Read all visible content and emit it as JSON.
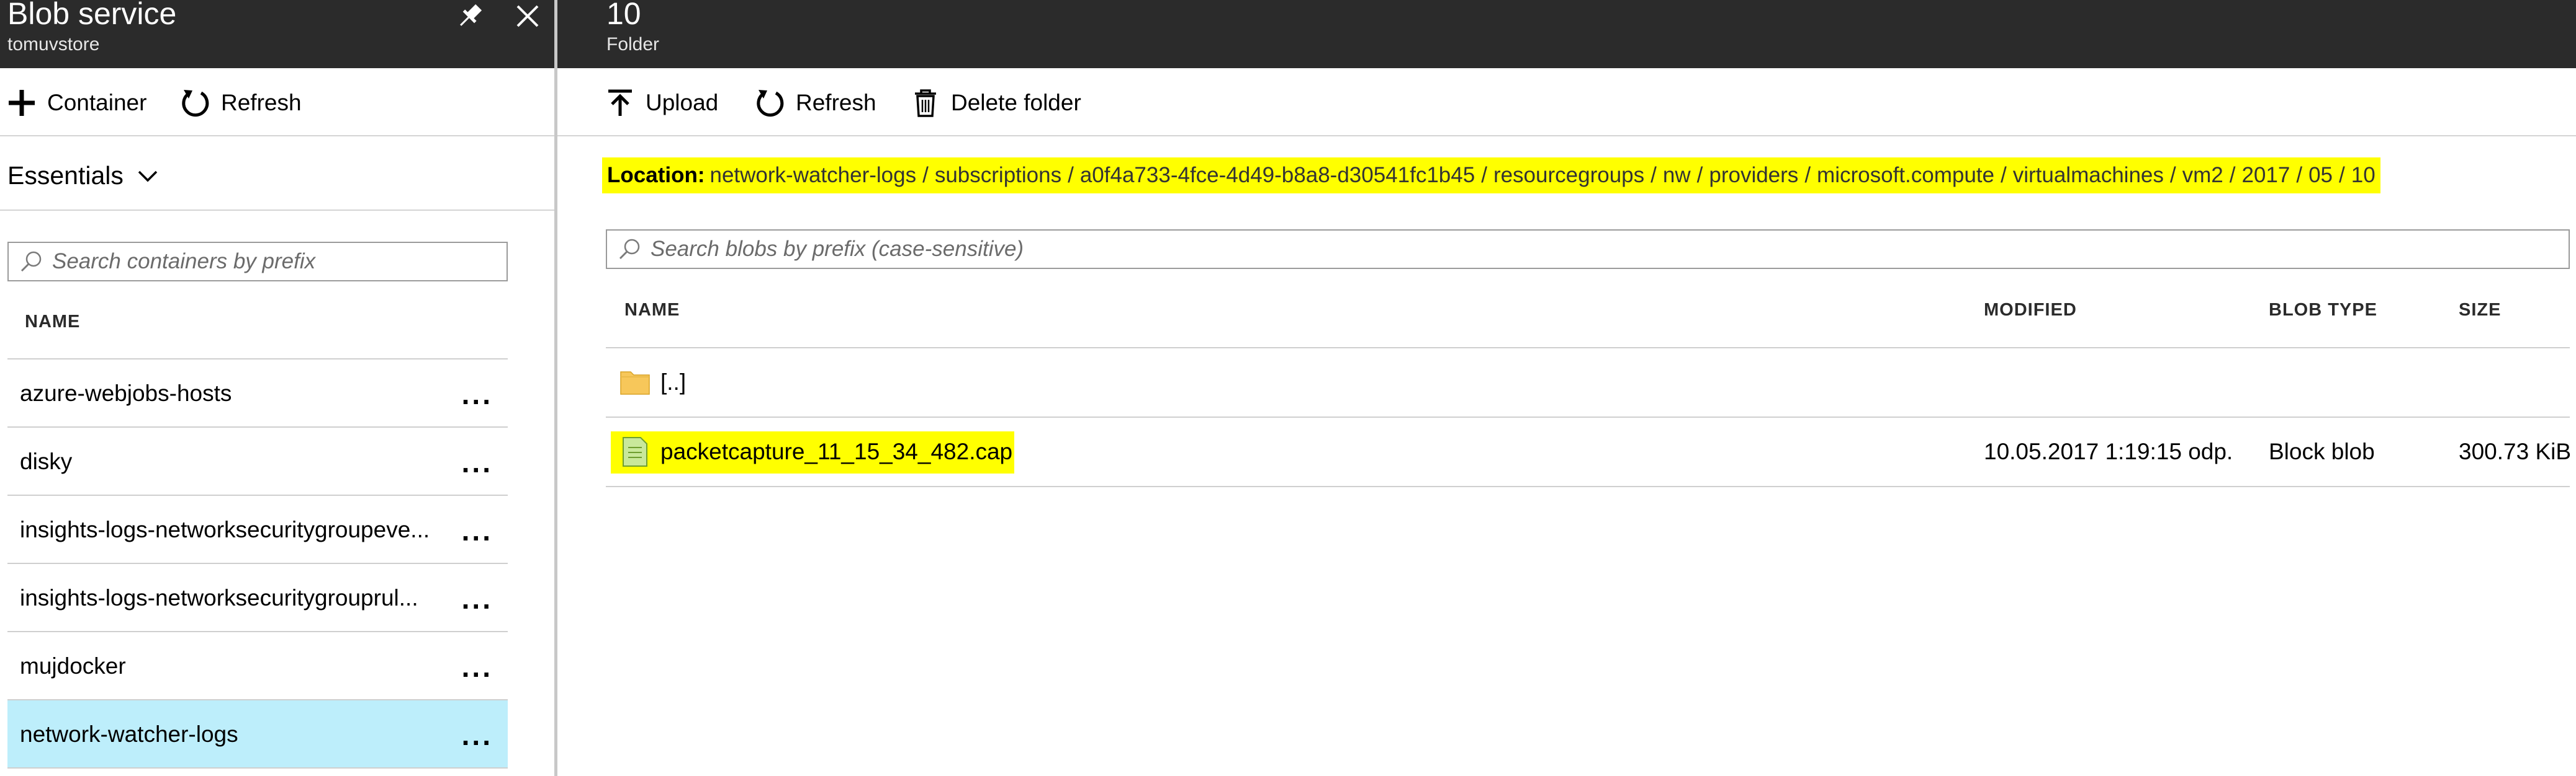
{
  "left_blade": {
    "title": "Blob service",
    "subtitle": "tomuvstore",
    "toolbar": {
      "container_label": "Container",
      "refresh_label": "Refresh"
    },
    "essentials_label": "Essentials",
    "search_placeholder": "Search containers by prefix",
    "column_name": "NAME",
    "containers": [
      {
        "name": "azure-webjobs-hosts",
        "more": "..."
      },
      {
        "name": "disky",
        "more": "..."
      },
      {
        "name": "insights-logs-networksecuritygroupeve...",
        "more": "..."
      },
      {
        "name": "insights-logs-networksecuritygrouprul...",
        "more": "..."
      },
      {
        "name": "mujdocker",
        "more": "..."
      },
      {
        "name": "network-watcher-logs",
        "more": "...",
        "selected": true
      }
    ]
  },
  "right_blade": {
    "title": "10",
    "subtitle": "Folder",
    "toolbar": {
      "upload_label": "Upload",
      "refresh_label": "Refresh",
      "delete_label": "Delete folder"
    },
    "location": {
      "label": "Location:",
      "segments": [
        "network-watcher-logs",
        "subscriptions",
        "a0f4a733-4fce-4d49-b8a8-d30541fc1b45",
        "resourcegroups",
        "nw",
        "providers",
        "microsoft.compute",
        "virtualmachines",
        "vm2",
        "2017",
        "05",
        "10"
      ],
      "separator": "/"
    },
    "search_placeholder": "Search blobs by prefix (case-sensitive)",
    "columns": {
      "name": "NAME",
      "modified": "MODIFIED",
      "blob_type": "BLOB TYPE",
      "size": "SIZE"
    },
    "parent_folder": "[..]",
    "blobs": [
      {
        "name": "packetcapture_11_15_34_482.cap",
        "modified": "10.05.2017 1:19:15 odp.",
        "blob_type": "Block blob",
        "size": "300.73 KiB"
      }
    ]
  },
  "colors": {
    "header_bg": "#2b2b2b",
    "selected_row": "#bdeefb",
    "highlight": "#ffff00",
    "folder": "#f7c75a",
    "file_icon": "#8cc63f"
  },
  "icons": [
    "pin-icon",
    "close-icon",
    "plus-icon",
    "refresh-icon",
    "chevron-down-icon",
    "search-icon",
    "upload-icon",
    "trash-icon",
    "folder-icon",
    "file-icon"
  ]
}
